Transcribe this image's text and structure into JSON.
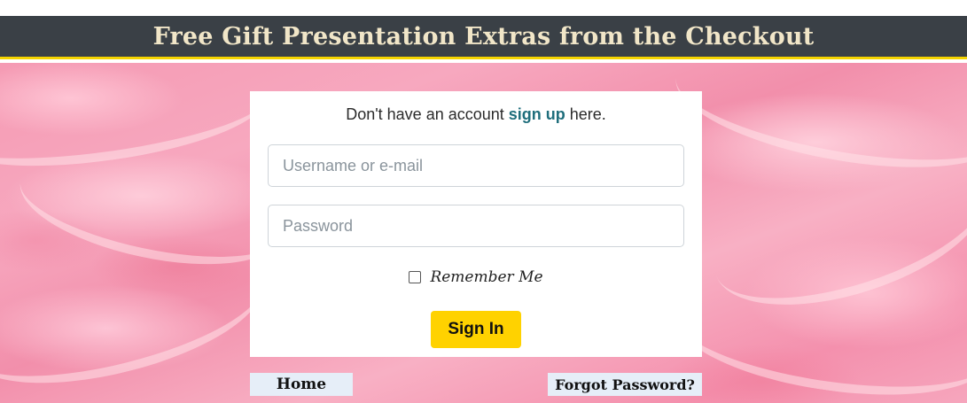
{
  "banner": {
    "title": "Free Gift Presentation Extras from the Checkout"
  },
  "signup": {
    "prefix": "Don't have an account ",
    "link": "sign up",
    "suffix": " here."
  },
  "login": {
    "username_placeholder": "Username or e-mail",
    "password_placeholder": "Password",
    "remember_label": "Remember Me",
    "remember_checked": false,
    "signin_label": "Sign In"
  },
  "footer": {
    "home_label": "Home",
    "forgot_label": "Forgot Password?"
  },
  "colors": {
    "banner_bg": "#3a4046",
    "banner_text": "#f1e6c8",
    "accent_yellow": "#ffd200",
    "link_teal": "#1f6e7c",
    "footer_link_bg": "#e6eef8"
  }
}
